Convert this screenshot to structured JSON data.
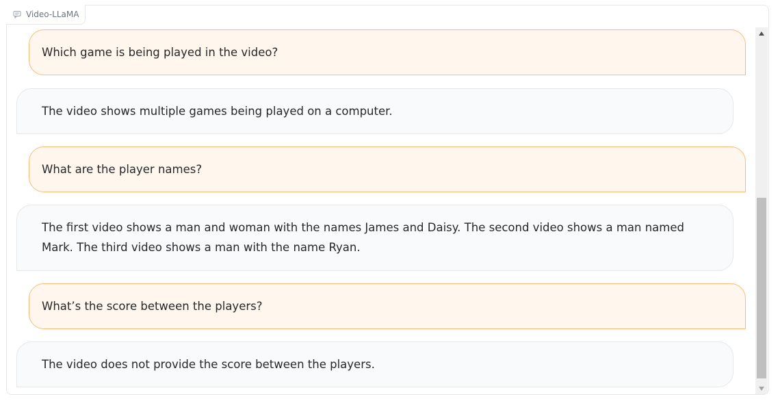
{
  "panel": {
    "label": "Video-LLaMA",
    "label_icon": "chat-icon"
  },
  "messages": [
    {
      "role": "user",
      "text": "Which game is being played in the video?"
    },
    {
      "role": "bot",
      "text": "The video shows multiple games being played on a computer."
    },
    {
      "role": "user",
      "text": "What are the player names?"
    },
    {
      "role": "bot",
      "text": "The first video shows a man and woman with the names James and Daisy. The second video shows a man named Mark. The third video shows a man with the name Ryan."
    },
    {
      "role": "user",
      "text": "What’s the score between the players?"
    },
    {
      "role": "bot",
      "text": "The video does not provide the score between the players."
    }
  ],
  "colors": {
    "user_bubble_bg": "#fff7ed",
    "user_bubble_border": "#fdba74",
    "bot_bubble_bg": "#f9fafb",
    "bot_bubble_border": "#e5e7eb"
  }
}
